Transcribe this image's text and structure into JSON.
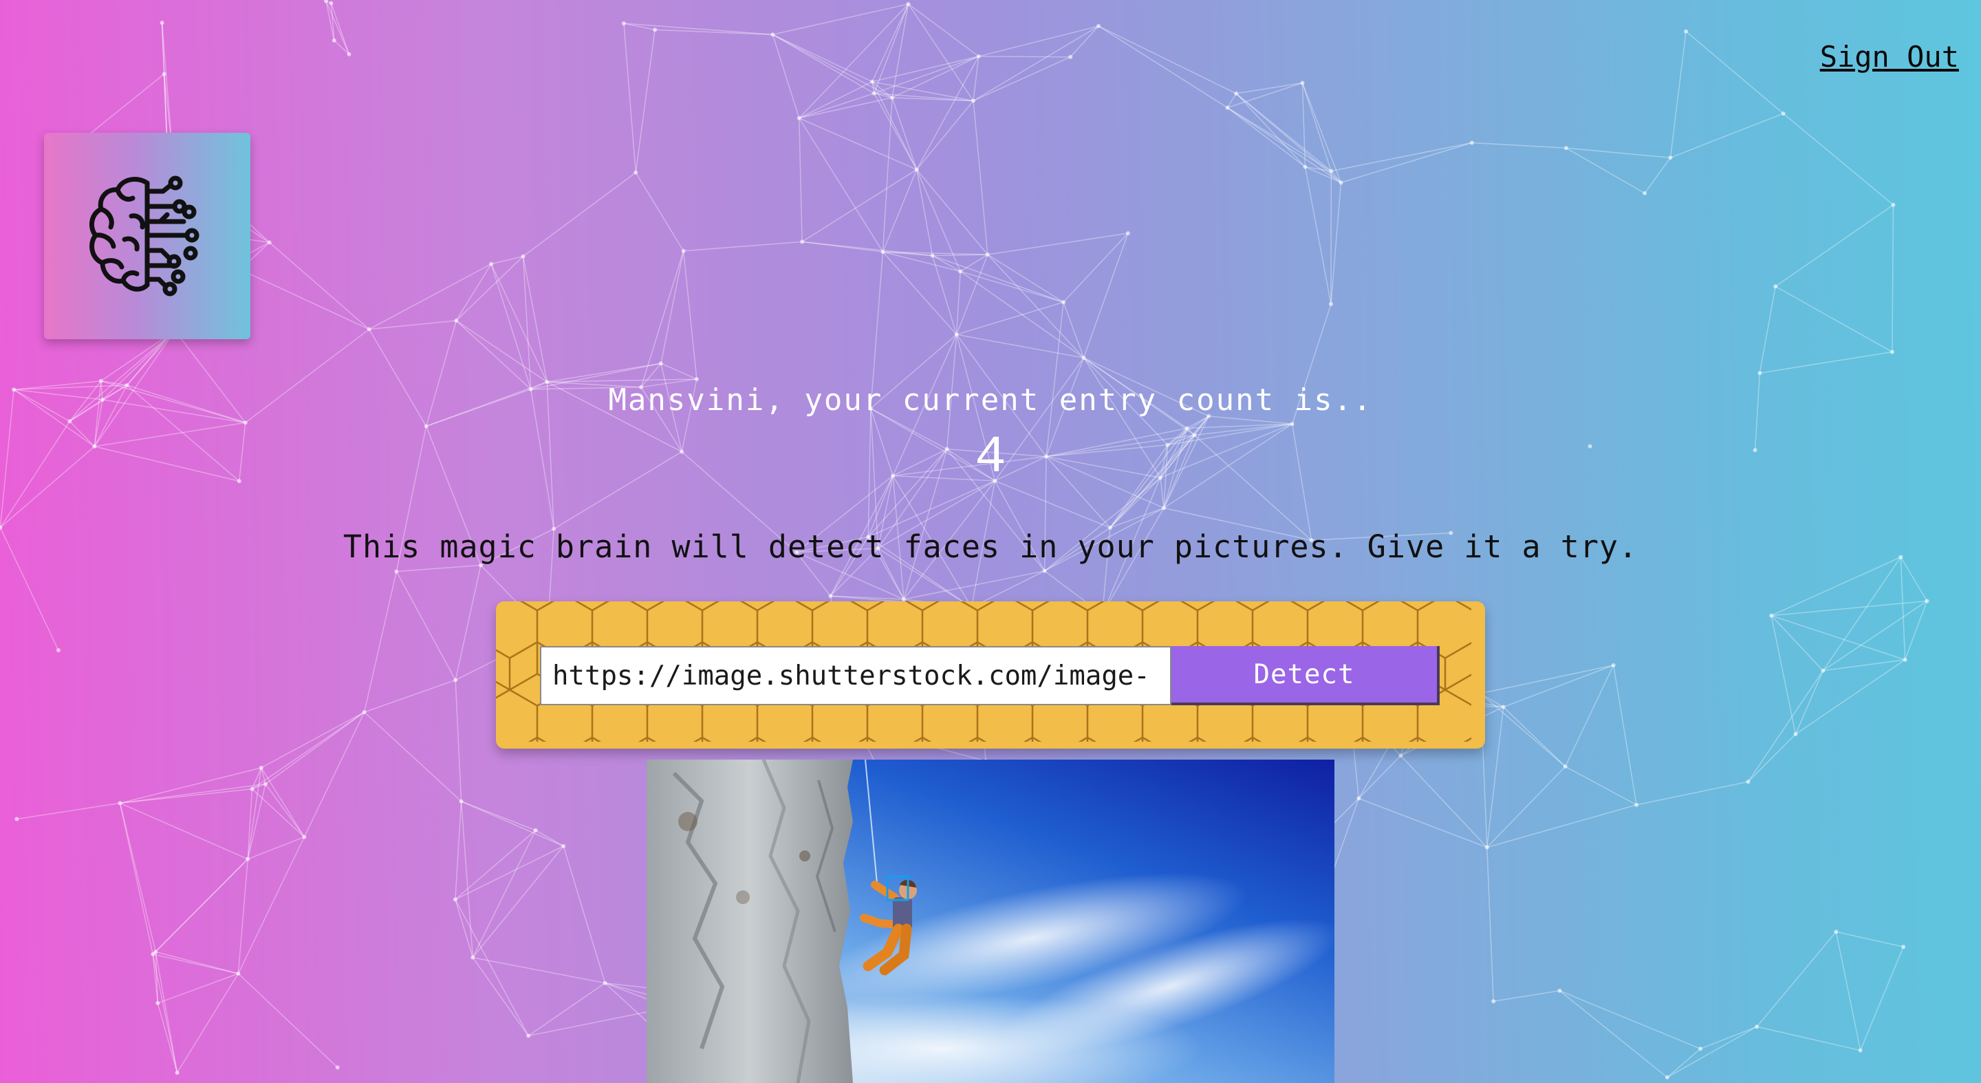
{
  "nav": {
    "signout_label": "Sign Out"
  },
  "logo": {
    "icon": "brain-circuit-icon"
  },
  "rank": {
    "message": "Mansvini, your current entry count is..",
    "count": "4"
  },
  "tagline": "This magic brain will detect faces in your pictures. Give it a try.",
  "form": {
    "url_value": "https://image.shutterstock.com/image-",
    "detect_label": "Detect"
  },
  "colors": {
    "gradient_left": "#ea5fd8",
    "gradient_right": "#5ec6de",
    "panel": "#f2bd48",
    "button": "#9a65e6",
    "face_box": "#149df2"
  }
}
